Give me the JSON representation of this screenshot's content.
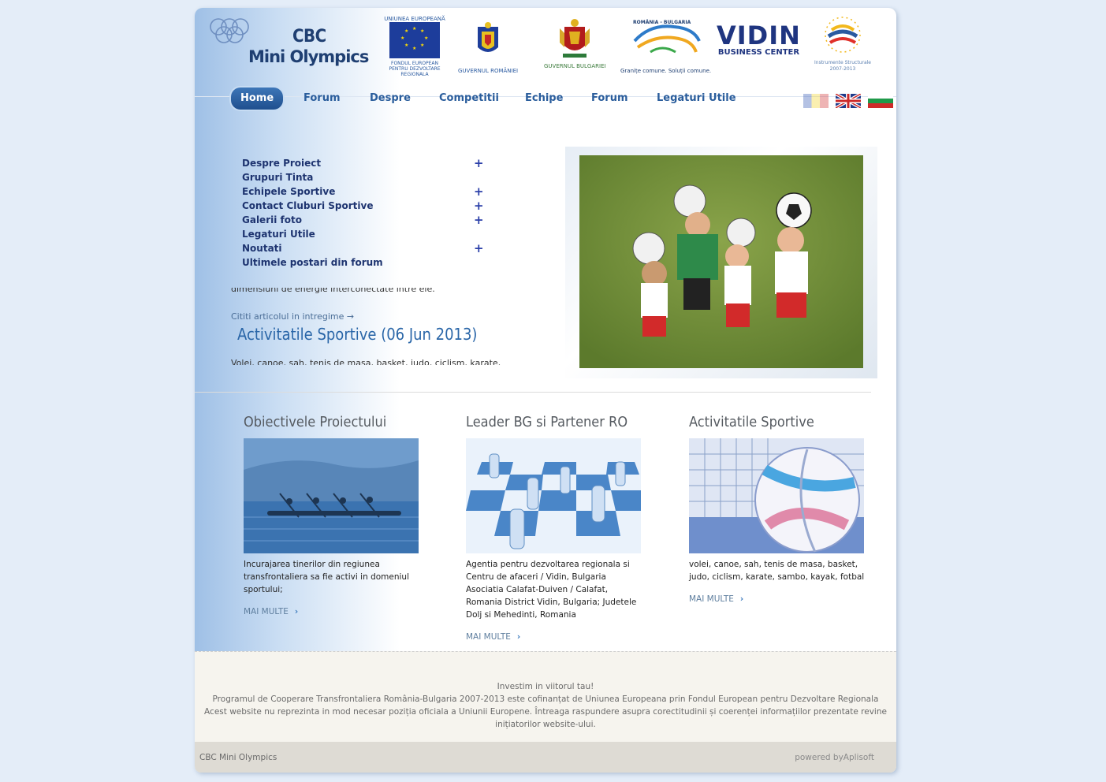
{
  "header": {
    "logo_line1": "CBC",
    "logo_line2": "Mini Olympics",
    "partners": [
      {
        "name": "eu-fund-logo",
        "caption": "UNIUNEA EUROPEANĂ",
        "caption2": "FONDUL EUROPEAN PENTRU DEZVOLTARE REGIONALA"
      },
      {
        "name": "romania-government-logo",
        "caption": "GUVERNUL ROMÂNIEI"
      },
      {
        "name": "bulgaria-government-logo",
        "caption": "GUVERNUL BULGARIEI"
      },
      {
        "name": "romania-bulgaria-program-logo",
        "caption": "ROMÂNIA - BULGARIA",
        "caption2": "Granițe comune. Soluții comune."
      },
      {
        "name": "vidin-business-center-logo",
        "caption": "VIDIN",
        "caption2": "BUSINESS CENTER"
      },
      {
        "name": "structural-instruments-logo",
        "caption": "Instrumente Structurale",
        "caption2": "2007-2013"
      }
    ]
  },
  "nav": {
    "items": [
      "Home",
      "Forum",
      "Despre",
      "Competitii",
      "Echipe",
      "Forum",
      "Legaturi Utile"
    ],
    "active": "Home"
  },
  "languages": [
    "romanian-flag-icon",
    "english-flag-icon",
    "bulgarian-flag-icon"
  ],
  "sidemenu": {
    "items": [
      {
        "label": "Despre Proiect",
        "expandable": true
      },
      {
        "label": "Grupuri Tinta",
        "expandable": false
      },
      {
        "label": "Echipele Sportive",
        "expandable": true
      },
      {
        "label": "Contact Cluburi Sportive",
        "expandable": true
      },
      {
        "label": "Galerii foto",
        "expandable": true
      },
      {
        "label": "Legaturi Utile",
        "expandable": false
      },
      {
        "label": "Noutati",
        "expandable": true
      },
      {
        "label": "Ultimele postari din forum",
        "expandable": false
      }
    ],
    "plus_symbol": "+"
  },
  "news": {
    "cut_text_top": "dimensiuni de energie interconectate intre ele.",
    "read_more": "Cititi articolul in intregime →",
    "title": "Activitatile Sportive (06 Jun 2013)",
    "cut_text_bottom": "Volei, canoe, sah, tenis de masa, basket, judo, ciclism, karate, sambo"
  },
  "columns": [
    {
      "title": "Obiectivele Proiectului",
      "text": "Incurajarea tinerilor din regiunea transfrontaliera sa fie activi in domeniul sportului;",
      "more": "MAI MULTE",
      "image": "kayak-image"
    },
    {
      "title": "Leader BG si Partener RO",
      "text": "Agentia pentru dezvoltarea regionala si Centru de afaceri / Vidin, Bulgaria Asociatia Calafat-Duiven / Calafat, Romania District Vidin, Bulgaria; Judetele Dolj si Mehedinti, Romania",
      "more": "MAI MULTE",
      "image": "chess-image"
    },
    {
      "title": "Activitatile Sportive",
      "text": "volei, canoe, sah, tenis de masa, basket, judo, ciclism, karate, sambo, kayak, fotbal",
      "more": "MAI MULTE",
      "image": "volleyball-image"
    }
  ],
  "footer": {
    "line1": "Investim in viitorul tau!",
    "line2": "Programul de Cooperare Transfrontaliera România-Bulgaria 2007-2013 este cofinanțat de Uniunea Europeana prin Fondul European pentru Dezvoltare Regionala",
    "line3": "Acest website nu reprezinta in mod necesar poziția oficiala a Uniunii Europene. Întreaga raspundere asupra corectitudinii și coerenței informațiilor prezentate revine inițiatorilor website-ului.",
    "site_name": "CBC Mini Olympics",
    "powered": "powered byAplisoft"
  }
}
